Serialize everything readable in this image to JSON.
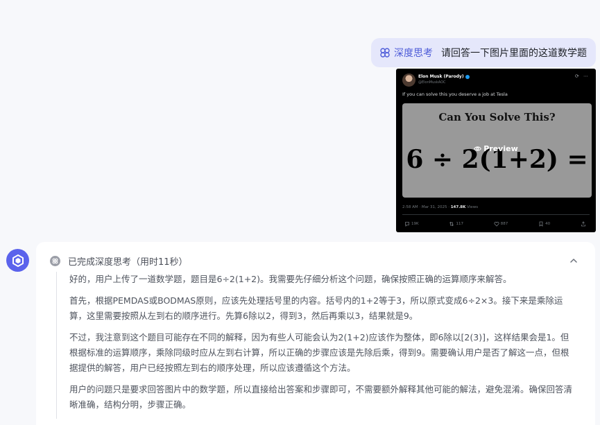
{
  "user_message": {
    "tag_label": "深度思考",
    "tag_icon": "deep-think-icon",
    "text": "请回答一下图片里面的这道数学题"
  },
  "tweet_image": {
    "author_name": "Elon Musk (Parody)",
    "author_handle": "@ElonMuskAOC",
    "caption": "If you can solve this you deserve a job at Tesla",
    "picture_title": "Can You Solve This?",
    "equation": "6 ÷ 2(1+2) =",
    "preview_label": "Preview",
    "timestamp": "2:58 AM · Mar 31, 2025 · ",
    "views_count": "147.8K",
    "views_label": " Views",
    "actions": {
      "reply": "19K",
      "repost": "117",
      "like": "887",
      "bookmark": "40"
    }
  },
  "assistant": {
    "avatar_icon": "assistant-logo-icon",
    "thinking": {
      "status": "已完成深度思考（用时11秒）",
      "paragraphs": [
        "好的，用户上传了一道数学题，题目是6÷2(1+2)。我需要先仔细分析这个问题，确保按照正确的运算顺序来解答。",
        "首先，根据PEMDAS或BODMAS原则，应该先处理括号里的内容。括号内的1+2等于3，所以原式变成6÷2×3。接下来是乘除运算，这里需要按照从左到右的顺序进行。先算6除以2，得到3，然后再乘以3，结果就是9。",
        "不过，我注意到这个题目可能存在不同的解释，因为有些人可能会认为2(1+2)应该作为整体，即6除以[2(3)]，这样结果会是1。但根据标准的运算顺序，乘除同级时应从左到右计算，所以正确的步骤应该是先除后乘，得到9。需要确认用户是否了解这一点，但根据提供的解答，用户已经按照左到右的顺序处理，所以应该遵循这个方法。",
        "用户的问题只是要求回答图片中的数学题，所以直接给出答案和步骤即可，不需要额外解释其他可能的解法，避免混淆。确保回答清晰准确，结构分明，步骤正确。"
      ]
    }
  },
  "colors": {
    "accent": "#5b63ec",
    "user_bubble": "#e5e7fb",
    "background": "#f7f8fb"
  }
}
